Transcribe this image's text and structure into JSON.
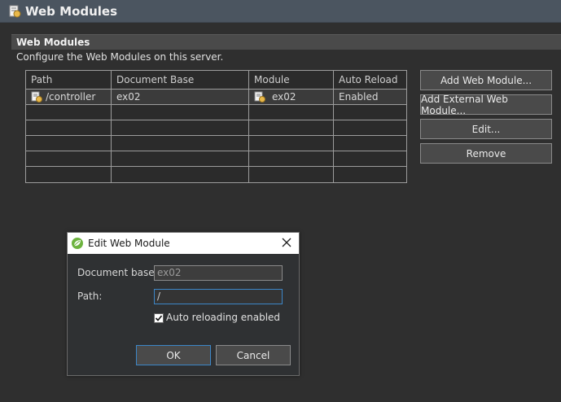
{
  "editor": {
    "title": "Web Modules",
    "section_title": "Web Modules",
    "description": "Configure the Web Modules on this server."
  },
  "table": {
    "columns": [
      "Path",
      "Document Base",
      "Module",
      "Auto Reload"
    ],
    "rows": [
      {
        "path": "/controller",
        "document_base": "ex02",
        "module": "ex02",
        "auto_reload": "Enabled"
      }
    ]
  },
  "buttons": {
    "add_web_module": "Add Web Module...",
    "add_external_web_module": "Add External Web Module...",
    "edit": "Edit...",
    "remove": "Remove"
  },
  "dialog": {
    "title": "Edit Web Module",
    "document_base_label": "Document base:",
    "document_base_value": "ex02",
    "path_label": "Path:",
    "path_value": "/",
    "auto_reload_label": "Auto reloading enabled",
    "auto_reload_checked": true,
    "ok_label": "OK",
    "cancel_label": "Cancel"
  },
  "colors": {
    "background": "#2f2f2f",
    "title_bar": "#4b5560",
    "focus_border": "#3c86c8"
  }
}
